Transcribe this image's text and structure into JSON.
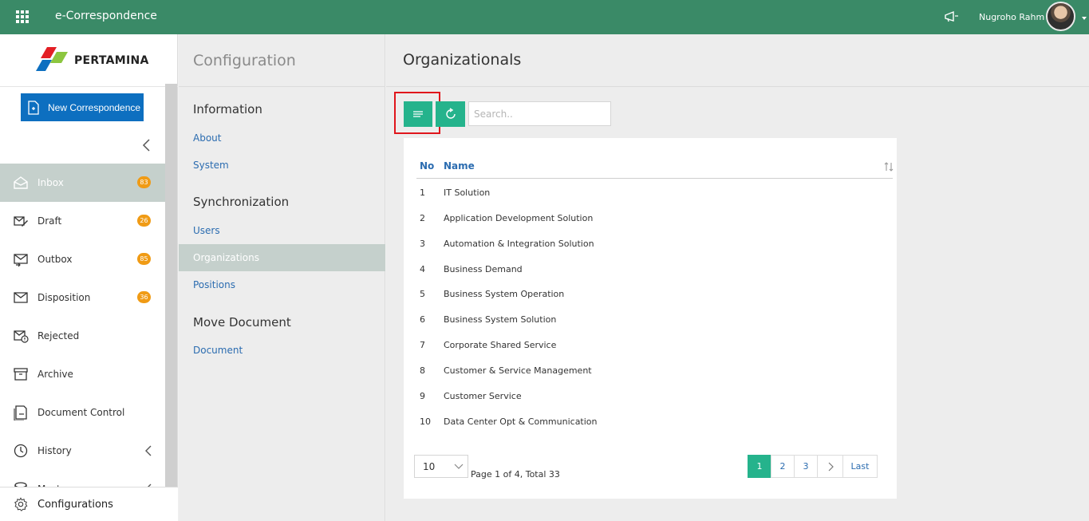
{
  "topbar": {
    "app_title": "e-Correspondence",
    "user_name": "Nugroho Rahm"
  },
  "sidebar": {
    "logo_text": "PERTAMINA",
    "new_button": "New Correspondence",
    "items": [
      {
        "label": "Inbox",
        "badge": "83",
        "icon": "inbox-icon",
        "active": true
      },
      {
        "label": "Draft",
        "badge": "26",
        "icon": "draft-icon"
      },
      {
        "label": "Outbox",
        "badge": "85",
        "icon": "outbox-icon"
      },
      {
        "label": "Disposition",
        "badge": "36",
        "icon": "disposition-icon"
      },
      {
        "label": "Rejected",
        "icon": "rejected-icon"
      },
      {
        "label": "Archive",
        "icon": "archive-icon"
      },
      {
        "label": "Document Control",
        "icon": "document-control-icon"
      },
      {
        "label": "History",
        "icon": "history-icon"
      },
      {
        "label": "Master",
        "icon": "master-icon"
      }
    ],
    "configurations": "Configurations"
  },
  "config_panel": {
    "title": "Configuration",
    "sections": [
      {
        "title": "Information",
        "links": [
          "About",
          "System"
        ]
      },
      {
        "title": "Synchronization",
        "links": [
          "Users",
          "Organizations",
          "Positions"
        ]
      },
      {
        "title": "Move Document",
        "links": [
          "Document"
        ]
      }
    ],
    "active_link": "Organizations"
  },
  "main": {
    "title": "Organizationals",
    "search_placeholder": "Search..",
    "table": {
      "columns": [
        "No",
        "Name"
      ],
      "rows": [
        {
          "no": "1",
          "name": "IT Solution"
        },
        {
          "no": "2",
          "name": "Application Development Solution"
        },
        {
          "no": "3",
          "name": "Automation & Integration Solution"
        },
        {
          "no": "4",
          "name": "Business Demand"
        },
        {
          "no": "5",
          "name": "Business System Operation"
        },
        {
          "no": "6",
          "name": "Business System Solution"
        },
        {
          "no": "7",
          "name": "Corporate Shared Service"
        },
        {
          "no": "8",
          "name": "Customer & Service Management"
        },
        {
          "no": "9",
          "name": "Customer Service"
        },
        {
          "no": "10",
          "name": "Data Center Opt & Communication"
        }
      ]
    },
    "page_size": "10",
    "page_info": "Page 1 of 4, Total 33",
    "pager": {
      "pages": [
        "1",
        "2",
        "3"
      ],
      "last": "Last",
      "current": "1"
    }
  },
  "colors": {
    "topbar": "#3a8a67",
    "primary_button": "#0d6fc0",
    "accent": "#25b38c",
    "badge": "#f09b15",
    "highlight": "#e0161c",
    "active_item": "#c5d0cc",
    "link": "#2b6cb0"
  }
}
